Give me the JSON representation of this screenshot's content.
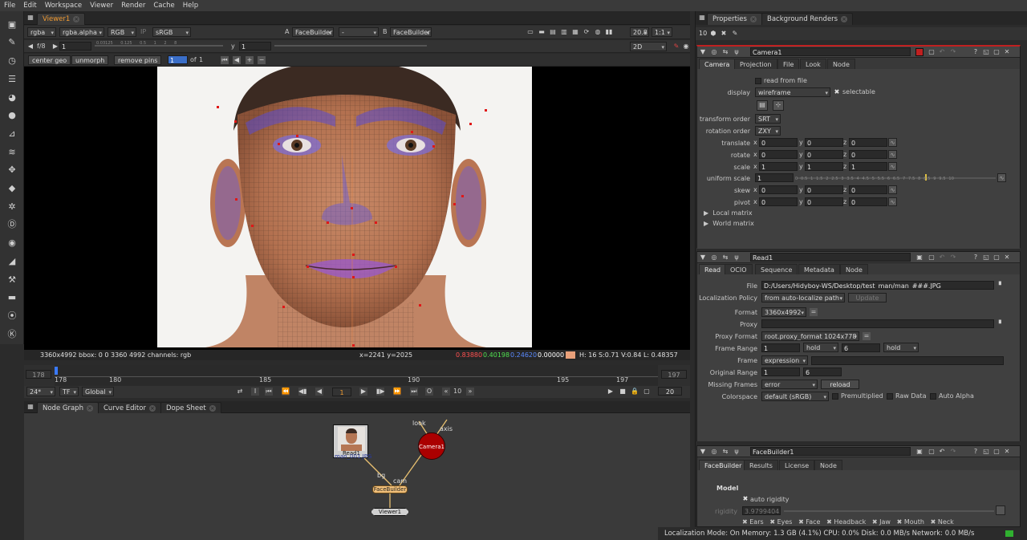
{
  "menu": [
    "File",
    "Edit",
    "Workspace",
    "Viewer",
    "Render",
    "Cache",
    "Help"
  ],
  "viewer": {
    "tab": "Viewer1",
    "channels": "rgba",
    "alpha": "rgba.alpha",
    "rgb": "RGB",
    "ip": "IP",
    "colorspace": "sRGB",
    "inputA_label": "A",
    "inputA": "FaceBuilder1",
    "dash": "-",
    "inputB_label": "B",
    "inputB": "FaceBuilder1",
    "zoom": "20.8",
    "ratio": "1:1",
    "fstop": "f/8",
    "gain": "1",
    "y_label": "y",
    "gamma": "1",
    "mode": "2D",
    "btn_center": "center geo",
    "btn_unmorph": "unmorph",
    "btn_remove": "remove pins",
    "frame": "1",
    "of": "of",
    "of_total": "1",
    "info_left": "3360x4992  bbox: 0 0 3360 4992 channels: rgb",
    "coords": "x=2241 y=2025",
    "r": "0.83880",
    "g": "0.40198",
    "b": "0.24620",
    "a": "0.00000",
    "hsv": "H: 16 S:0.71 V:0.84  L: 0.48357",
    "gain_ticks": [
      "0.03125",
      "0.125",
      "0.5",
      "1",
      "2",
      "8"
    ]
  },
  "timeline": {
    "start": "178",
    "end": "197",
    "ticks": [
      "178",
      "180",
      "185",
      "190",
      "195",
      "197"
    ],
    "fps": "24*",
    "tf": "TF",
    "global": "Global",
    "current": "1",
    "step": "10",
    "end_frame": "20"
  },
  "nodegraph": {
    "tabs": [
      "Node Graph",
      "Curve Editor",
      "Dope Sheet"
    ],
    "read_label": "Read1",
    "read_file": "man_001.JPG",
    "camera": "Camera1",
    "facebuilder": "FaceBuilder",
    "viewer": "Viewer1",
    "look": "look",
    "axis": "axis",
    "bg": "bg",
    "cam": "cam"
  },
  "right": {
    "tabs": [
      "Properties",
      "Background Renders"
    ],
    "max_panels": "10"
  },
  "camera": {
    "name": "Camera1",
    "tabs": [
      "Camera",
      "Projection",
      "File",
      "Look",
      "Node"
    ],
    "read_from_file": "read from file",
    "display_label": "display",
    "display": "wireframe",
    "selectable": "selectable",
    "transform_order_label": "transform order",
    "transform_order": "SRT",
    "rotation_order_label": "rotation order",
    "rotation_order": "ZXY",
    "translate": "translate",
    "rotate": "rotate",
    "scale": "scale",
    "skew": "skew",
    "pivot": "pivot",
    "uniform_scale": "uniform scale",
    "uniform_value": "1",
    "x": "x",
    "y": "y",
    "z": "z",
    "tx": "0",
    "ty": "0",
    "tz": "0",
    "rx": "0",
    "ry": "0",
    "rz": "0",
    "sx": "1",
    "sy": "1",
    "sz": "1",
    "kx": "0",
    "ky": "0",
    "kz": "0",
    "px": "0",
    "py": "0",
    "pz": "0",
    "local_matrix": "Local matrix",
    "world_matrix": "World matrix",
    "slider_ticks": [
      "0",
      "0.5",
      "1",
      "1.5",
      "2",
      "2.5",
      "3",
      "3.5",
      "4",
      "4.5",
      "5",
      "5.5",
      "6",
      "6.5",
      "7",
      "7.5",
      "8",
      "8.5",
      "9",
      "9.5",
      "10"
    ]
  },
  "read": {
    "name": "Read1",
    "tabs": [
      "Read",
      "OCIO",
      "Sequence",
      "Metadata",
      "Node"
    ],
    "file_label": "File",
    "file": "D:/Users/Hidyboy-WS/Desktop/test_man/man_###.JPG",
    "localization_label": "Localization Policy",
    "localization": "from auto-localize path",
    "update": "Update",
    "format_label": "Format",
    "format": "3360x4992",
    "proxy_label": "Proxy",
    "proxy_format_label": "Proxy Format",
    "proxy_format": "root.proxy_format 1024x778",
    "frame_range_label": "Frame Range",
    "fr_start": "1",
    "fr_hold1": "hold",
    "fr_end": "6",
    "fr_hold2": "hold",
    "frame_label": "Frame",
    "frame_mode": "expression",
    "original_range_label": "Original Range",
    "or_start": "1",
    "or_end": "6",
    "missing_label": "Missing Frames",
    "missing": "error",
    "reload": "reload",
    "colorspace_label": "Colorspace",
    "colorspace": "default (sRGB)",
    "premultiplied": "Premultiplied",
    "raw": "Raw Data",
    "auto_alpha": "Auto Alpha"
  },
  "facebuilder": {
    "name": "FaceBuilder1",
    "tabs": [
      "FaceBuilder",
      "Results",
      "License",
      "Node"
    ],
    "model": "Model",
    "auto_rigidity": "auto rigidity",
    "rigidity_label": "rigidity",
    "rigidity": "3.97994043",
    "parts": [
      "Ears",
      "Eyes",
      "Face",
      "Headback",
      "Jaw",
      "Mouth",
      "Neck"
    ]
  },
  "status": "Localization Mode: On Memory: 1.3 GB (4.1%) CPU: 0.0% Disk: 0.0 MB/s Network: 0.0 MB/s"
}
